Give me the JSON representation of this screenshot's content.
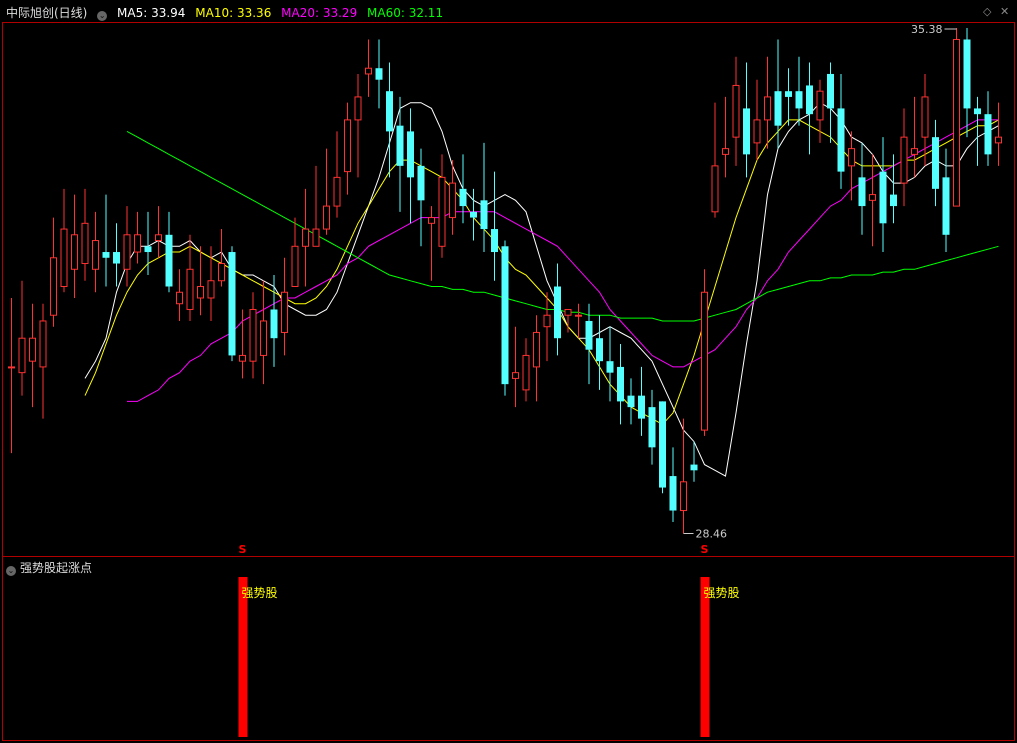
{
  "header": {
    "stock": "中际旭创(日线)",
    "ma": [
      {
        "label": "MA5: 33.94",
        "color": "#ffffff"
      },
      {
        "label": "MA10: 33.36",
        "color": "#ffff00"
      },
      {
        "label": "MA20: 33.29",
        "color": "#ff00ff"
      },
      {
        "label": "MA60: 32.11",
        "color": "#00ff00"
      }
    ]
  },
  "sub_panel": {
    "title": "强势股起涨点",
    "signal_label": "强势股",
    "marker": "S"
  },
  "annotations": {
    "high": "35.38",
    "low": "28.46"
  },
  "colors": {
    "up": "#ff3232",
    "down": "#54ffff",
    "frame": "#b00000",
    "signal": "#ff0000",
    "signal_text": "#ffff00"
  },
  "chart_data": [
    {
      "type": "candlestick",
      "title": "中际旭创(日线)",
      "ylim": [
        27.4,
        36.4
      ],
      "candles": [
        [
          30.5,
          30.5,
          31.7,
          29.0
        ],
        [
          30.4,
          31.0,
          32.0,
          30.0
        ],
        [
          30.6,
          31.0,
          31.6,
          29.8
        ],
        [
          30.5,
          31.3,
          31.6,
          29.6
        ],
        [
          31.4,
          32.4,
          33.1,
          31.2
        ],
        [
          31.9,
          32.9,
          33.6,
          31.8
        ],
        [
          32.2,
          32.8,
          33.5,
          31.7
        ],
        [
          32.3,
          33.0,
          33.6,
          32.0
        ],
        [
          32.2,
          32.7,
          33.2,
          31.8
        ],
        [
          32.5,
          32.4,
          33.5,
          31.9
        ],
        [
          32.5,
          32.3,
          33.0,
          31.9
        ],
        [
          32.2,
          32.8,
          33.3,
          31.9
        ],
        [
          32.5,
          32.8,
          33.2,
          32.3
        ],
        [
          32.6,
          32.5,
          33.2,
          32.1
        ],
        [
          32.7,
          32.8,
          33.3,
          32.4
        ],
        [
          32.8,
          31.9,
          33.2,
          31.8
        ],
        [
          31.6,
          31.8,
          32.2,
          31.3
        ],
        [
          31.5,
          32.2,
          32.8,
          31.3
        ],
        [
          31.7,
          31.9,
          32.6,
          31.4
        ],
        [
          31.7,
          32.0,
          32.6,
          31.3
        ],
        [
          32.0,
          32.3,
          32.9,
          31.9
        ],
        [
          32.5,
          30.7,
          32.6,
          30.6
        ],
        [
          30.6,
          30.7,
          31.5,
          30.3
        ],
        [
          30.6,
          31.5,
          31.8,
          30.3
        ],
        [
          30.7,
          31.3,
          32.0,
          30.2
        ],
        [
          31.5,
          31.0,
          32.1,
          30.5
        ],
        [
          31.1,
          31.8,
          32.4,
          30.7
        ],
        [
          31.9,
          32.6,
          33.1,
          31.9
        ],
        [
          32.6,
          32.9,
          33.6,
          31.9
        ],
        [
          32.6,
          32.9,
          34.0,
          32.6
        ],
        [
          32.9,
          33.3,
          34.3,
          32.8
        ],
        [
          33.3,
          33.8,
          34.6,
          33.1
        ],
        [
          33.9,
          34.8,
          35.1,
          33.5
        ],
        [
          34.8,
          35.2,
          35.6,
          33.8
        ],
        [
          35.6,
          35.7,
          36.2,
          35.2
        ],
        [
          35.7,
          35.5,
          36.2,
          35.0
        ],
        [
          35.3,
          34.6,
          35.8,
          33.8
        ],
        [
          34.7,
          34.0,
          35.2,
          33.2
        ],
        [
          34.6,
          33.8,
          35.0,
          33.0
        ],
        [
          34.0,
          33.4,
          34.3,
          32.6
        ],
        [
          33.0,
          33.1,
          33.3,
          32.0
        ],
        [
          32.6,
          33.8,
          34.2,
          32.4
        ],
        [
          33.1,
          33.7,
          34.1,
          32.8
        ],
        [
          33.6,
          33.3,
          34.2,
          33.0
        ],
        [
          33.2,
          33.1,
          33.6,
          32.7
        ],
        [
          33.4,
          32.9,
          34.4,
          32.5
        ],
        [
          32.9,
          32.5,
          33.9,
          32.0
        ],
        [
          32.6,
          30.2,
          32.7,
          30.0
        ],
        [
          30.3,
          30.4,
          31.2,
          29.8
        ],
        [
          30.1,
          30.7,
          31.0,
          29.9
        ],
        [
          30.5,
          31.1,
          31.4,
          29.9
        ],
        [
          31.2,
          31.4,
          31.8,
          30.6
        ],
        [
          31.9,
          31.0,
          32.3,
          30.7
        ],
        [
          31.4,
          31.5,
          31.5,
          31.1
        ],
        [
          31.4,
          31.4,
          31.6,
          31.0
        ],
        [
          31.3,
          30.8,
          31.6,
          30.2
        ],
        [
          31.0,
          30.6,
          31.4,
          30.1
        ],
        [
          30.6,
          30.4,
          31.2,
          29.9
        ],
        [
          30.5,
          29.9,
          30.9,
          29.5
        ],
        [
          30.0,
          29.8,
          30.3,
          29.5
        ],
        [
          30.0,
          29.6,
          30.5,
          29.3
        ],
        [
          29.8,
          29.1,
          30.1,
          28.8
        ],
        [
          29.9,
          28.4,
          29.9,
          28.3
        ],
        [
          28.6,
          28.0,
          29.1,
          27.8
        ],
        [
          28.0,
          28.5,
          29.6,
          27.6
        ],
        [
          28.8,
          28.7,
          29.2,
          28.5
        ],
        [
          29.4,
          31.8,
          32.2,
          29.3
        ],
        [
          33.2,
          34.0,
          35.1,
          33.1
        ],
        [
          34.2,
          34.3,
          35.2,
          33.8
        ],
        [
          34.5,
          35.4,
          35.9,
          34.0
        ],
        [
          35.0,
          34.2,
          35.8,
          33.8
        ],
        [
          34.4,
          34.8,
          35.5,
          34.1
        ],
        [
          34.8,
          35.2,
          35.9,
          34.3
        ],
        [
          35.3,
          34.7,
          36.2,
          34.3
        ],
        [
          35.3,
          35.2,
          35.7,
          34.7
        ],
        [
          35.3,
          35.0,
          35.9,
          34.7
        ],
        [
          35.4,
          34.9,
          35.8,
          34.2
        ],
        [
          34.8,
          35.3,
          35.5,
          34.4
        ],
        [
          35.6,
          35.0,
          35.8,
          34.4
        ],
        [
          35.0,
          33.9,
          35.6,
          33.6
        ],
        [
          34.0,
          34.3,
          34.6,
          33.4
        ],
        [
          33.8,
          33.3,
          34.4,
          32.8
        ],
        [
          33.4,
          33.5,
          34.2,
          32.6
        ],
        [
          33.9,
          33.0,
          34.5,
          32.5
        ],
        [
          33.5,
          33.3,
          34.2,
          33.0
        ],
        [
          33.7,
          34.5,
          35.0,
          33.3
        ],
        [
          34.2,
          34.3,
          35.2,
          33.8
        ],
        [
          34.5,
          35.2,
          35.6,
          34.0
        ],
        [
          34.5,
          33.6,
          34.8,
          33.3
        ],
        [
          33.8,
          32.8,
          34.3,
          32.5
        ],
        [
          33.3,
          36.2,
          36.4,
          33.3
        ],
        [
          36.2,
          35.0,
          36.4,
          34.5
        ],
        [
          35.0,
          34.9,
          35.2,
          34.0
        ],
        [
          34.9,
          34.2,
          35.3,
          34.0
        ],
        [
          34.4,
          34.5,
          35.1,
          34.0
        ]
      ],
      "ma_lines": [
        {
          "label": "MA5",
          "color": "#ffffff",
          "values": [
            30.3,
            30.6,
            31.0,
            31.8,
            32.3,
            32.6,
            32.6,
            32.7,
            32.6,
            32.6,
            32.7,
            32.5,
            32.4,
            32.5,
            32.2,
            32.1,
            32.1,
            32.0,
            31.9,
            31.6,
            31.5,
            31.4,
            31.4,
            31.5,
            31.8,
            32.3,
            32.8,
            33.3,
            33.8,
            34.4,
            35.0,
            35.1,
            35.1,
            35.0,
            34.6,
            34.0,
            33.6,
            33.4,
            33.3,
            33.4,
            33.5,
            33.4,
            33.2,
            32.6,
            32.0,
            31.6,
            31.2,
            31.0,
            31.0,
            31.1,
            31.2,
            31.1,
            31.0,
            30.8,
            30.6,
            30.2,
            29.8,
            29.4,
            29.2,
            28.8,
            28.7,
            28.6,
            29.7,
            30.9,
            32.0,
            33.5,
            34.3,
            34.6,
            34.8,
            34.9,
            35.1,
            35.0,
            34.8,
            34.5,
            34.4,
            34.2,
            33.9,
            33.7,
            33.7,
            33.8,
            34.0,
            34.1,
            34.0,
            34.0,
            34.3,
            34.5,
            34.6,
            34.7
          ]
        },
        {
          "label": "MA10",
          "color": "#ffff00",
          "values": [
            30.0,
            30.4,
            30.9,
            31.4,
            31.8,
            32.1,
            32.3,
            32.4,
            32.5,
            32.5,
            32.6,
            32.5,
            32.4,
            32.3,
            32.2,
            32.1,
            32.0,
            31.9,
            31.8,
            31.7,
            31.6,
            31.6,
            31.7,
            31.9,
            32.2,
            32.6,
            33.0,
            33.3,
            33.6,
            33.9,
            34.1,
            34.1,
            34.0,
            33.9,
            33.8,
            33.6,
            33.4,
            33.1,
            32.9,
            32.7,
            32.4,
            32.2,
            32.1,
            31.9,
            31.7,
            31.5,
            31.2,
            31.0,
            30.8,
            30.5,
            30.2,
            30.0,
            29.8,
            29.7,
            29.6,
            29.5,
            29.7,
            30.2,
            30.7,
            31.3,
            31.9,
            32.5,
            33.1,
            33.6,
            34.1,
            34.4,
            34.6,
            34.8,
            34.8,
            34.7,
            34.6,
            34.5,
            34.3,
            34.1,
            34.0,
            34.0,
            34.0,
            34.0,
            34.1,
            34.1,
            34.2,
            34.3,
            34.4,
            34.5,
            34.6,
            34.7,
            34.7,
            34.8
          ]
        },
        {
          "label": "MA20",
          "color": "#ff00ff",
          "values": [
            29.9,
            29.9,
            30.0,
            30.1,
            30.3,
            30.4,
            30.6,
            30.7,
            30.9,
            31.0,
            31.1,
            31.3,
            31.4,
            31.5,
            31.6,
            31.7,
            31.7,
            31.8,
            31.9,
            32.0,
            32.1,
            32.3,
            32.4,
            32.6,
            32.7,
            32.8,
            32.9,
            33.0,
            33.1,
            33.1,
            33.1,
            33.2,
            33.2,
            33.2,
            33.2,
            33.2,
            33.1,
            33.0,
            32.9,
            32.8,
            32.7,
            32.6,
            32.4,
            32.2,
            32.0,
            31.8,
            31.5,
            31.3,
            31.1,
            30.9,
            30.7,
            30.6,
            30.5,
            30.5,
            30.6,
            30.7,
            30.8,
            31.0,
            31.2,
            31.5,
            31.7,
            32.0,
            32.2,
            32.5,
            32.7,
            32.9,
            33.1,
            33.3,
            33.4,
            33.6,
            33.7,
            33.8,
            33.9,
            34.0,
            34.1,
            34.2,
            34.3,
            34.4,
            34.5,
            34.6,
            34.7,
            34.8,
            34.8,
            34.8
          ]
        },
        {
          "label": "MA60",
          "color": "#00ff00",
          "values": [
            34.6,
            34.5,
            34.4,
            34.3,
            34.2,
            34.1,
            34.0,
            33.9,
            33.8,
            33.7,
            33.6,
            33.5,
            33.4,
            33.3,
            33.2,
            33.1,
            33.0,
            32.9,
            32.8,
            32.7,
            32.6,
            32.5,
            32.4,
            32.3,
            32.2,
            32.1,
            32.05,
            32.0,
            31.95,
            31.9,
            31.9,
            31.85,
            31.85,
            31.8,
            31.8,
            31.75,
            31.7,
            31.65,
            31.6,
            31.55,
            31.5,
            31.5,
            31.45,
            31.45,
            31.4,
            31.4,
            31.4,
            31.35,
            31.35,
            31.35,
            31.35,
            31.3,
            31.3,
            31.3,
            31.3,
            31.35,
            31.4,
            31.45,
            31.5,
            31.6,
            31.7,
            31.8,
            31.85,
            31.9,
            31.95,
            32.0,
            32.0,
            32.05,
            32.05,
            32.1,
            32.1,
            32.1,
            32.15,
            32.15,
            32.2,
            32.2,
            32.25,
            32.3,
            32.35,
            32.4,
            32.45,
            32.5,
            32.55,
            32.6
          ]
        }
      ]
    },
    {
      "type": "bar",
      "title": "强势股起涨点",
      "signals": [
        22,
        66
      ]
    }
  ]
}
